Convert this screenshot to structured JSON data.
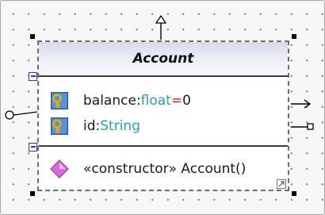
{
  "class": {
    "name": "Account",
    "attributes": [
      {
        "name": "balance",
        "sep": ":",
        "type": "float",
        "assign": "=",
        "default": "0",
        "icon": "key-property-icon"
      },
      {
        "name": "id",
        "sep": ":",
        "type": "String",
        "icon": "key-property-icon"
      }
    ],
    "operations": [
      {
        "stereotype": "«constructor»",
        "name": "Account()",
        "icon": "operation-diamond-icon"
      }
    ]
  },
  "colors": {
    "header_top": "#d8d8ec",
    "type_text": "#2aa0a6",
    "default_value": "#cc2020",
    "key_icon": "#e6b200",
    "operation_icon": "#d86ad8",
    "collapse_button": "#2c3ab8"
  }
}
